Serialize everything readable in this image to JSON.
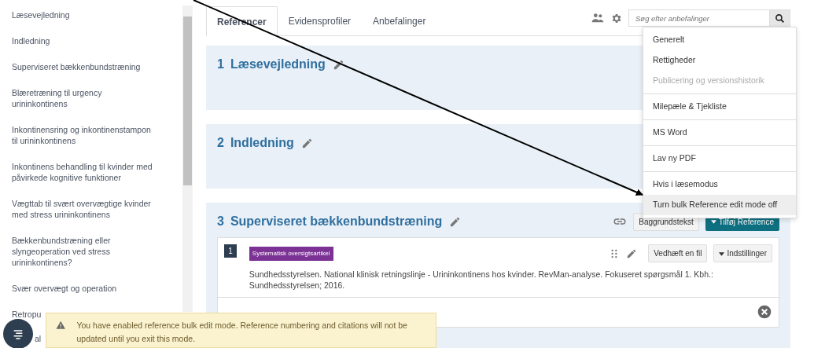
{
  "sidebar": {
    "items": [
      {
        "label": "Læsevejledning"
      },
      {
        "label": "Indledning"
      },
      {
        "label": "Superviseret bækkenbundstræning"
      },
      {
        "label": "Blæretræning til urgency urininkontinens"
      },
      {
        "label": "Inkontinensring og inkontinenstampon til urininkontinens"
      },
      {
        "label": "Inkontinens behandling til kvinder med påvirkede kognitive funktioner"
      },
      {
        "label": "Vægttab til svært overvægtige kvinder med stress urininkontinens"
      },
      {
        "label": "Bækkenbundstræning eller slyngeoperation ved stress urininkontinens?"
      },
      {
        "label": "Svær overvægt og operation"
      },
      {
        "label": "Retropu"
      },
      {
        "label": "al"
      }
    ]
  },
  "tabs": [
    {
      "label": "Referencer",
      "selected": true
    },
    {
      "label": "Evidensprofiler",
      "selected": false
    },
    {
      "label": "Anbefalinger",
      "selected": false
    }
  ],
  "search": {
    "placeholder": "Søg efter anbefalinger"
  },
  "settings_menu": {
    "items": [
      {
        "label": "Generelt",
        "disabled": false,
        "divider_after": false,
        "highlighted": false
      },
      {
        "label": "Rettigheder",
        "disabled": false,
        "divider_after": false,
        "highlighted": false
      },
      {
        "label": "Publicering og versionshistorik",
        "disabled": true,
        "divider_after": true,
        "highlighted": false
      },
      {
        "label": "Milepæle & Tjekliste",
        "disabled": false,
        "divider_after": true,
        "highlighted": false
      },
      {
        "label": "MS Word",
        "disabled": false,
        "divider_after": true,
        "highlighted": false
      },
      {
        "label": "Lav ny PDF",
        "disabled": false,
        "divider_after": true,
        "highlighted": false
      },
      {
        "label": "Hvis i læsemodus",
        "disabled": false,
        "divider_after": false,
        "highlighted": false
      },
      {
        "label": "Turn bulk Reference edit mode off",
        "disabled": false,
        "divider_after": false,
        "highlighted": true
      }
    ]
  },
  "sections": [
    {
      "number": "1",
      "title": "Læsevejledning"
    },
    {
      "number": "2",
      "title": "Indledning"
    },
    {
      "number": "3",
      "title": "Superviseret bækkenbundstræning",
      "background_button": "Baggrundstekst",
      "add_button": "Tilføj Reference",
      "references": [
        {
          "number": "1",
          "tag": "Systematisk oversigtsartikel",
          "attach_button": "Vedhæft en fil",
          "settings_button": "Indstillinger",
          "citation": "Sundhedsstyrelsen. National klinisk retningslinje - Urininkontinens hos kvinder. RevMan-analyse. Fokuseret spørgsmål 1. Kbh.: Sundhedsstyrelsen; 2016."
        }
      ]
    }
  ],
  "toast": {
    "message": "You have enabled reference bulk edit mode. Reference numbering and citations will not be updated until you exit this mode."
  }
}
